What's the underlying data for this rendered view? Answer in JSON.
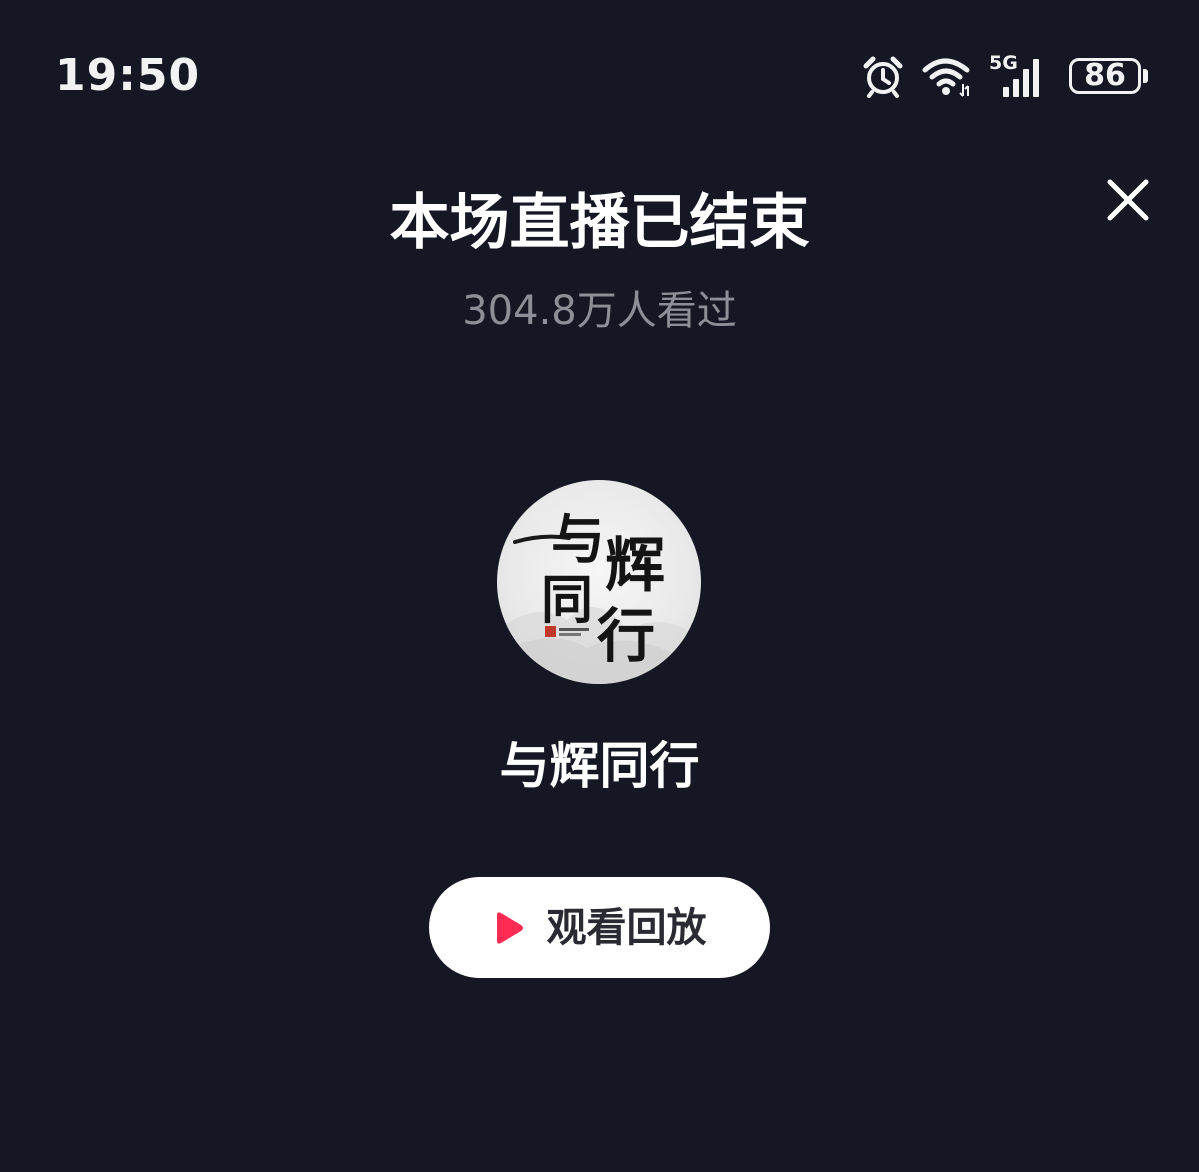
{
  "status_bar": {
    "time": "19:50",
    "network_label": "5G",
    "battery": "86",
    "icons": [
      "alarm-icon",
      "wifi-icon",
      "cellular-signal-icon",
      "battery-icon"
    ]
  },
  "header": {
    "title": "本场直播已结束",
    "viewers": "304.8万人看过",
    "close_icon": "close-icon"
  },
  "streamer": {
    "name": "与辉同行",
    "avatar_text": [
      "与",
      "辉",
      "同",
      "行"
    ]
  },
  "actions": {
    "replay_label": "观看回放",
    "replay_icon": "play-icon"
  },
  "colors": {
    "background": "#161724",
    "subtext": "#8d8e97",
    "play_accent": "#fe2c55",
    "button_bg": "#ffffff"
  }
}
